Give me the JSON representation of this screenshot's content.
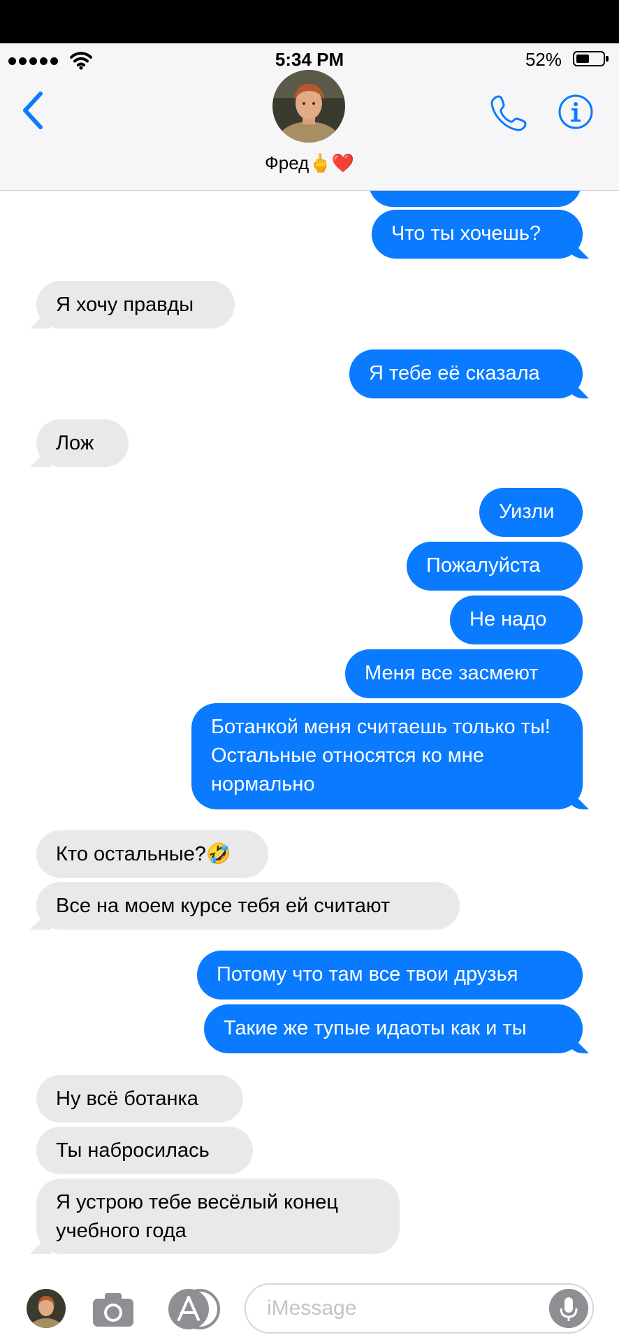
{
  "status_bar": {
    "time": "5:34 PM",
    "battery_percent": "52%",
    "battery_level": 0.52,
    "signal_bars": 5
  },
  "header": {
    "contact_name": "Фред🖕❤️",
    "back_icon": "chevron-left-icon",
    "call_icon": "phone-icon",
    "info_icon": "info-icon"
  },
  "messages": [
    {
      "side": "out",
      "text": ""
    },
    {
      "side": "out",
      "text": "Что ты хочешь?"
    },
    {
      "side": "in",
      "text": "Я хочу правды"
    },
    {
      "side": "out",
      "text": "Я тебе её сказала"
    },
    {
      "side": "in",
      "text": "Лож"
    },
    {
      "side": "out",
      "text": "Уизли"
    },
    {
      "side": "out",
      "text": "Пожалуйста"
    },
    {
      "side": "out",
      "text": "Не надо"
    },
    {
      "side": "out",
      "text": "Меня все засмеют"
    },
    {
      "side": "out",
      "text": "Ботанкой меня считаешь только ты! Остальные относятся ко мне нормально"
    },
    {
      "side": "in",
      "text": "Кто остальные?🤣"
    },
    {
      "side": "in",
      "text": "Все на моем курсе тебя ей считают"
    },
    {
      "side": "out",
      "text": "Потому что там все твои друзья"
    },
    {
      "side": "out",
      "text": "Такие же тупые идаоты как и ты"
    },
    {
      "side": "in",
      "text": "Ну всё ботанка"
    },
    {
      "side": "in",
      "text": "Ты набросилась"
    },
    {
      "side": "in",
      "text": "Я устрою тебе весёлый конец учебного года"
    }
  ],
  "input_bar": {
    "placeholder": "iMessage",
    "value": "",
    "camera_icon": "camera-icon",
    "apps_icon": "app-store-icon",
    "mic_icon": "microphone-icon"
  },
  "colors": {
    "outgoing_bubble": "#0a7aff",
    "incoming_bubble": "#e9e9eb",
    "accent": "#0a7aff"
  }
}
